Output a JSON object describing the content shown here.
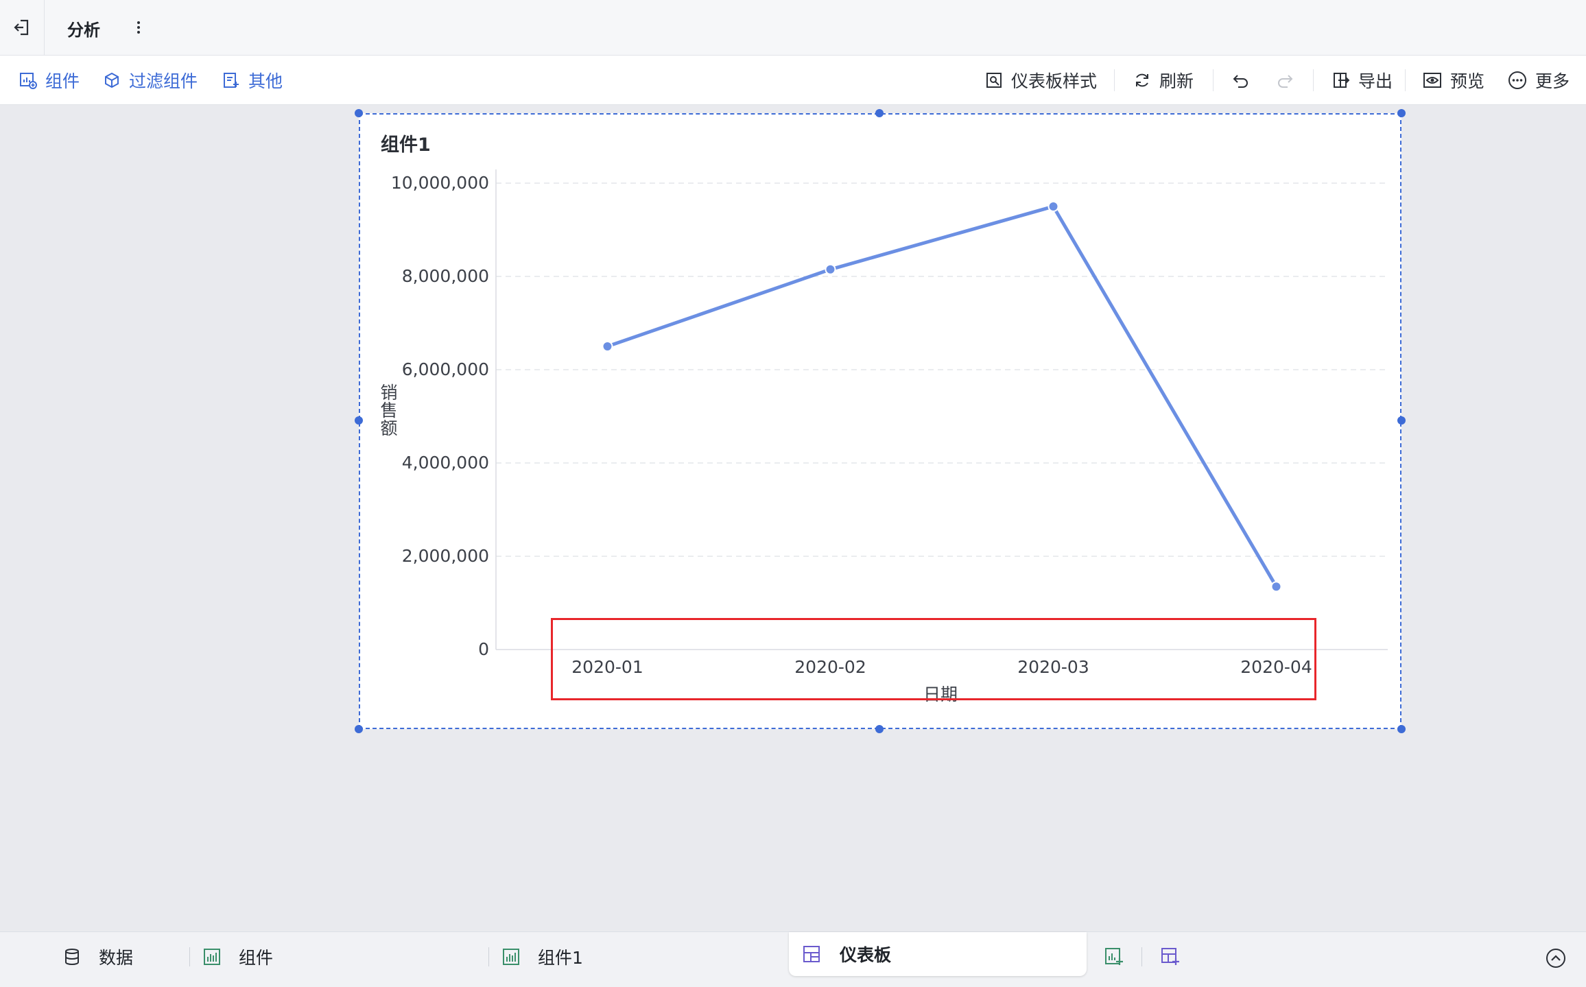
{
  "app": {
    "title": "分析"
  },
  "toolbar": {
    "left": [
      {
        "label": "组件",
        "icon": "add-chart-icon"
      },
      {
        "label": "过滤组件",
        "icon": "filter-cube-icon"
      },
      {
        "label": "其他",
        "icon": "other-doc-icon"
      }
    ],
    "right": {
      "style_label": "仪表板样式",
      "refresh_label": "刷新",
      "export_label": "导出",
      "preview_label": "预览",
      "more_label": "更多"
    }
  },
  "widget": {
    "title": "组件1"
  },
  "chart_data": {
    "type": "line",
    "categories": [
      "2020-01",
      "2020-02",
      "2020-03",
      "2020-04"
    ],
    "series": [
      {
        "values": [
          6500000,
          8150000,
          9500000,
          1350000
        ]
      }
    ],
    "xlabel": "日期",
    "ylabel": "销售额",
    "ylim": [
      0,
      10000000
    ],
    "yticks": [
      "0",
      "2,000,000",
      "4,000,000",
      "6,000,000",
      "8,000,000",
      "10,000,000"
    ],
    "grid": true,
    "color": "#6b8fe3"
  },
  "tabs": {
    "data_label": "数据",
    "component_label": "组件",
    "component1_label": "组件1",
    "dashboard_label": "仪表板"
  },
  "colors": {
    "accent": "#3d6bd6",
    "highlight": "#e8262b",
    "line": "#6b8fe3"
  }
}
